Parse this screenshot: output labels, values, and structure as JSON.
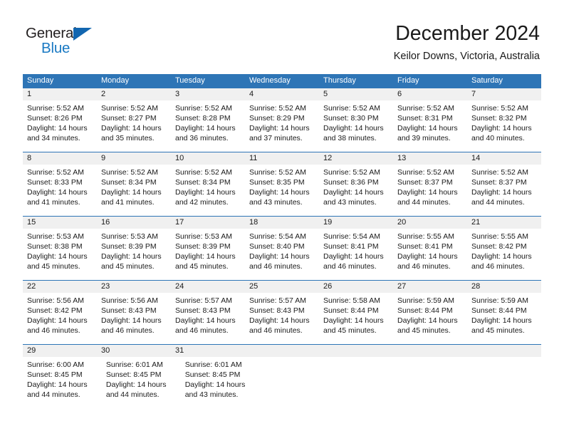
{
  "brand": {
    "name_part1": "General",
    "name_part2": "Blue",
    "triangle_icon": "triangle-icon",
    "colors": {
      "dark": "#231f20",
      "blue": "#1979c3",
      "triangle": "#1266b0"
    }
  },
  "header": {
    "title": "December 2024",
    "subtitle": "Keilor Downs, Victoria, Australia"
  },
  "colors": {
    "header_blue": "#2e75b6",
    "daynum_strip": "#f0f0f0",
    "text": "#1a1a1a"
  },
  "calendar": {
    "weekday_headers": [
      "Sunday",
      "Monday",
      "Tuesday",
      "Wednesday",
      "Thursday",
      "Friday",
      "Saturday"
    ],
    "weeks": [
      {
        "days": [
          {
            "num": "1",
            "sunrise": "Sunrise: 5:52 AM",
            "sunset": "Sunset: 8:26 PM",
            "daylight1": "Daylight: 14 hours",
            "daylight2": "and 34 minutes."
          },
          {
            "num": "2",
            "sunrise": "Sunrise: 5:52 AM",
            "sunset": "Sunset: 8:27 PM",
            "daylight1": "Daylight: 14 hours",
            "daylight2": "and 35 minutes."
          },
          {
            "num": "3",
            "sunrise": "Sunrise: 5:52 AM",
            "sunset": "Sunset: 8:28 PM",
            "daylight1": "Daylight: 14 hours",
            "daylight2": "and 36 minutes."
          },
          {
            "num": "4",
            "sunrise": "Sunrise: 5:52 AM",
            "sunset": "Sunset: 8:29 PM",
            "daylight1": "Daylight: 14 hours",
            "daylight2": "and 37 minutes."
          },
          {
            "num": "5",
            "sunrise": "Sunrise: 5:52 AM",
            "sunset": "Sunset: 8:30 PM",
            "daylight1": "Daylight: 14 hours",
            "daylight2": "and 38 minutes."
          },
          {
            "num": "6",
            "sunrise": "Sunrise: 5:52 AM",
            "sunset": "Sunset: 8:31 PM",
            "daylight1": "Daylight: 14 hours",
            "daylight2": "and 39 minutes."
          },
          {
            "num": "7",
            "sunrise": "Sunrise: 5:52 AM",
            "sunset": "Sunset: 8:32 PM",
            "daylight1": "Daylight: 14 hours",
            "daylight2": "and 40 minutes."
          }
        ]
      },
      {
        "days": [
          {
            "num": "8",
            "sunrise": "Sunrise: 5:52 AM",
            "sunset": "Sunset: 8:33 PM",
            "daylight1": "Daylight: 14 hours",
            "daylight2": "and 41 minutes."
          },
          {
            "num": "9",
            "sunrise": "Sunrise: 5:52 AM",
            "sunset": "Sunset: 8:34 PM",
            "daylight1": "Daylight: 14 hours",
            "daylight2": "and 41 minutes."
          },
          {
            "num": "10",
            "sunrise": "Sunrise: 5:52 AM",
            "sunset": "Sunset: 8:34 PM",
            "daylight1": "Daylight: 14 hours",
            "daylight2": "and 42 minutes."
          },
          {
            "num": "11",
            "sunrise": "Sunrise: 5:52 AM",
            "sunset": "Sunset: 8:35 PM",
            "daylight1": "Daylight: 14 hours",
            "daylight2": "and 43 minutes."
          },
          {
            "num": "12",
            "sunrise": "Sunrise: 5:52 AM",
            "sunset": "Sunset: 8:36 PM",
            "daylight1": "Daylight: 14 hours",
            "daylight2": "and 43 minutes."
          },
          {
            "num": "13",
            "sunrise": "Sunrise: 5:52 AM",
            "sunset": "Sunset: 8:37 PM",
            "daylight1": "Daylight: 14 hours",
            "daylight2": "and 44 minutes."
          },
          {
            "num": "14",
            "sunrise": "Sunrise: 5:52 AM",
            "sunset": "Sunset: 8:37 PM",
            "daylight1": "Daylight: 14 hours",
            "daylight2": "and 44 minutes."
          }
        ]
      },
      {
        "days": [
          {
            "num": "15",
            "sunrise": "Sunrise: 5:53 AM",
            "sunset": "Sunset: 8:38 PM",
            "daylight1": "Daylight: 14 hours",
            "daylight2": "and 45 minutes."
          },
          {
            "num": "16",
            "sunrise": "Sunrise: 5:53 AM",
            "sunset": "Sunset: 8:39 PM",
            "daylight1": "Daylight: 14 hours",
            "daylight2": "and 45 minutes."
          },
          {
            "num": "17",
            "sunrise": "Sunrise: 5:53 AM",
            "sunset": "Sunset: 8:39 PM",
            "daylight1": "Daylight: 14 hours",
            "daylight2": "and 45 minutes."
          },
          {
            "num": "18",
            "sunrise": "Sunrise: 5:54 AM",
            "sunset": "Sunset: 8:40 PM",
            "daylight1": "Daylight: 14 hours",
            "daylight2": "and 46 minutes."
          },
          {
            "num": "19",
            "sunrise": "Sunrise: 5:54 AM",
            "sunset": "Sunset: 8:41 PM",
            "daylight1": "Daylight: 14 hours",
            "daylight2": "and 46 minutes."
          },
          {
            "num": "20",
            "sunrise": "Sunrise: 5:55 AM",
            "sunset": "Sunset: 8:41 PM",
            "daylight1": "Daylight: 14 hours",
            "daylight2": "and 46 minutes."
          },
          {
            "num": "21",
            "sunrise": "Sunrise: 5:55 AM",
            "sunset": "Sunset: 8:42 PM",
            "daylight1": "Daylight: 14 hours",
            "daylight2": "and 46 minutes."
          }
        ]
      },
      {
        "days": [
          {
            "num": "22",
            "sunrise": "Sunrise: 5:56 AM",
            "sunset": "Sunset: 8:42 PM",
            "daylight1": "Daylight: 14 hours",
            "daylight2": "and 46 minutes."
          },
          {
            "num": "23",
            "sunrise": "Sunrise: 5:56 AM",
            "sunset": "Sunset: 8:43 PM",
            "daylight1": "Daylight: 14 hours",
            "daylight2": "and 46 minutes."
          },
          {
            "num": "24",
            "sunrise": "Sunrise: 5:57 AM",
            "sunset": "Sunset: 8:43 PM",
            "daylight1": "Daylight: 14 hours",
            "daylight2": "and 46 minutes."
          },
          {
            "num": "25",
            "sunrise": "Sunrise: 5:57 AM",
            "sunset": "Sunset: 8:43 PM",
            "daylight1": "Daylight: 14 hours",
            "daylight2": "and 46 minutes."
          },
          {
            "num": "26",
            "sunrise": "Sunrise: 5:58 AM",
            "sunset": "Sunset: 8:44 PM",
            "daylight1": "Daylight: 14 hours",
            "daylight2": "and 45 minutes."
          },
          {
            "num": "27",
            "sunrise": "Sunrise: 5:59 AM",
            "sunset": "Sunset: 8:44 PM",
            "daylight1": "Daylight: 14 hours",
            "daylight2": "and 45 minutes."
          },
          {
            "num": "28",
            "sunrise": "Sunrise: 5:59 AM",
            "sunset": "Sunset: 8:44 PM",
            "daylight1": "Daylight: 14 hours",
            "daylight2": "and 45 minutes."
          }
        ]
      },
      {
        "days": [
          {
            "num": "29",
            "sunrise": "Sunrise: 6:00 AM",
            "sunset": "Sunset: 8:45 PM",
            "daylight1": "Daylight: 14 hours",
            "daylight2": "and 44 minutes."
          },
          {
            "num": "30",
            "sunrise": "Sunrise: 6:01 AM",
            "sunset": "Sunset: 8:45 PM",
            "daylight1": "Daylight: 14 hours",
            "daylight2": "and 44 minutes."
          },
          {
            "num": "31",
            "sunrise": "Sunrise: 6:01 AM",
            "sunset": "Sunset: 8:45 PM",
            "daylight1": "Daylight: 14 hours",
            "daylight2": "and 43 minutes."
          },
          {
            "num": "",
            "sunrise": "",
            "sunset": "",
            "daylight1": "",
            "daylight2": ""
          },
          {
            "num": "",
            "sunrise": "",
            "sunset": "",
            "daylight1": "",
            "daylight2": ""
          },
          {
            "num": "",
            "sunrise": "",
            "sunset": "",
            "daylight1": "",
            "daylight2": ""
          },
          {
            "num": "",
            "sunrise": "",
            "sunset": "",
            "daylight1": "",
            "daylight2": ""
          }
        ]
      }
    ]
  }
}
